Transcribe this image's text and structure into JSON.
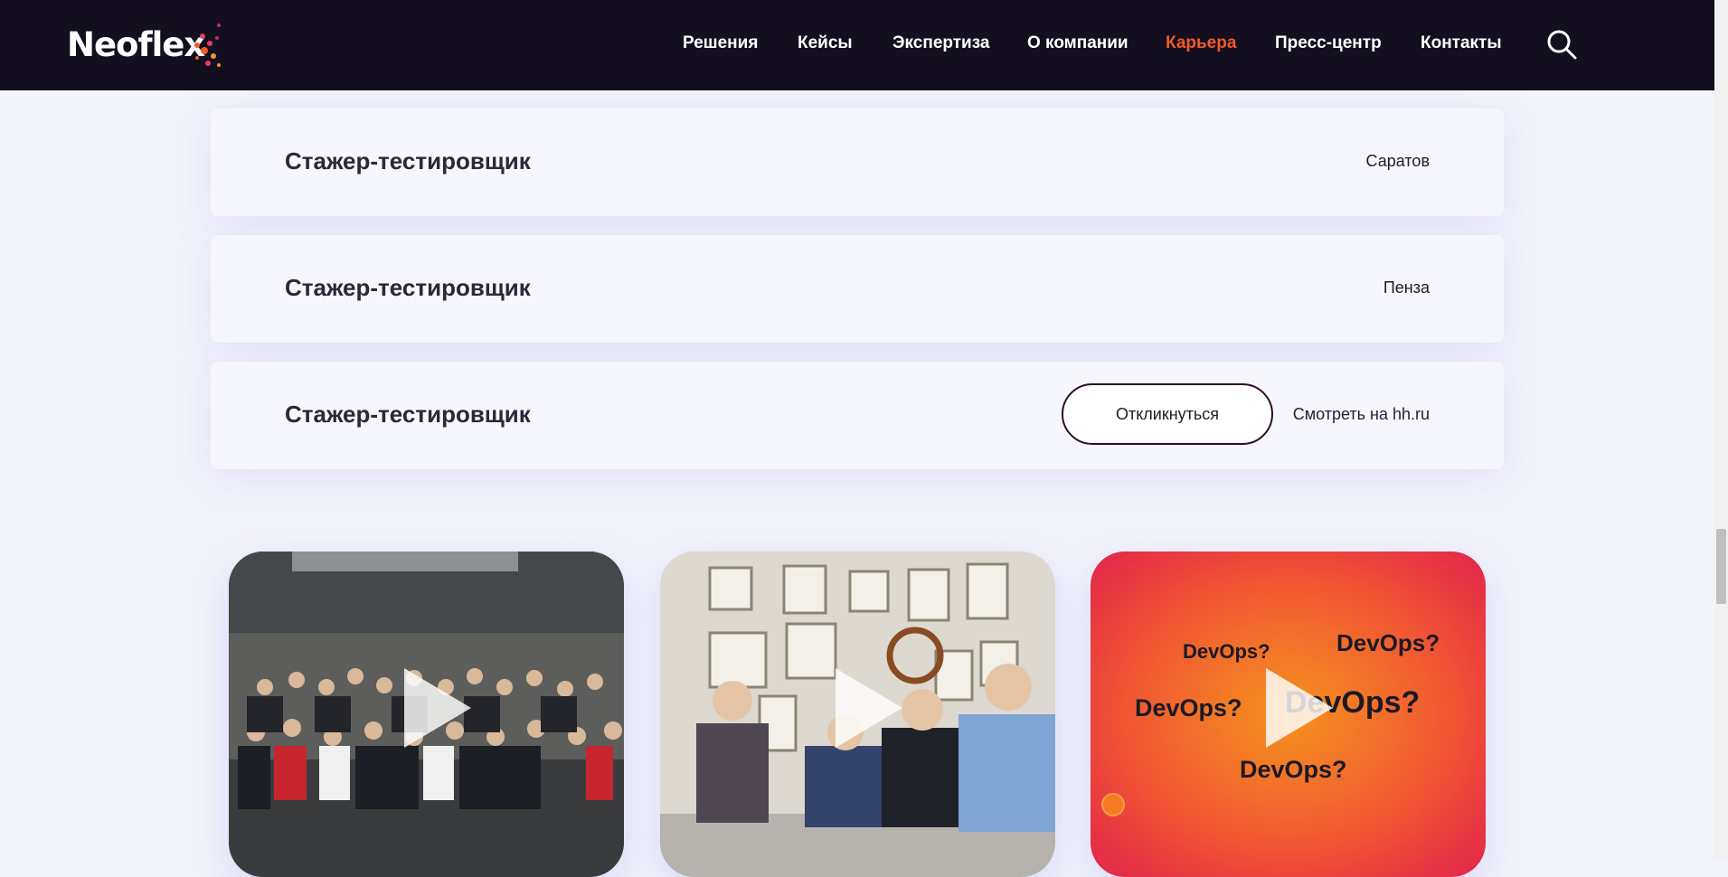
{
  "header": {
    "logo_text": "Neoflex",
    "nav": [
      {
        "label": "Решения"
      },
      {
        "label": "Кейсы"
      },
      {
        "label": "Экспертиза"
      },
      {
        "label": "О компании"
      },
      {
        "label": "Карьера",
        "active": true
      },
      {
        "label": "Пресс-центр"
      },
      {
        "label": "Контакты"
      }
    ],
    "search_icon": "search-icon"
  },
  "colors": {
    "header_bg": "#140f1f",
    "accent": "#f15a29",
    "page_bg": "#f3f3fb"
  },
  "vacancies": [
    {
      "title": "Стажер-тестировщик",
      "city": "Саратов"
    },
    {
      "title": "Стажер-тестировщик",
      "city": "Пенза"
    },
    {
      "title": "Стажер-тестировщик",
      "respond_label": "Откликнуться",
      "hh_link_label": "Смотреть на hh.ru"
    }
  ],
  "videos": [
    {
      "name": "team-group-photo",
      "icon": "play-icon"
    },
    {
      "name": "meeting-photo",
      "icon": "play-icon"
    },
    {
      "name": "devops-video",
      "icon": "play-icon",
      "words": [
        "DevOps?",
        "DevOps?",
        "DevOps?",
        "DevOps?",
        "DevOps?"
      ]
    }
  ]
}
